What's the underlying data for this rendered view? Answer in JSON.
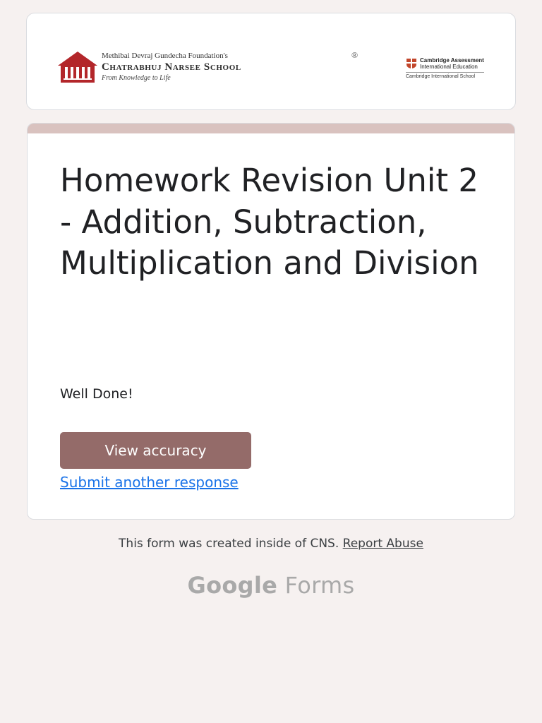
{
  "banner": {
    "school_foundation": "Methibai Devraj Gundecha Foundation's",
    "school_name": "Chatrabhuj Narsee School",
    "school_registered": "®",
    "school_tagline": "From Knowledge to Life",
    "cambridge_line1": "Cambridge Assessment",
    "cambridge_line2": "International Education",
    "cambridge_sub": "Cambridge International School"
  },
  "form": {
    "title": "Homework Revision Unit 2 - Addition, Subtraction, Multiplication and Division",
    "message": "Well Done!",
    "view_accuracy_label": "View accuracy",
    "submit_another_label": "Submit another response"
  },
  "footer": {
    "created_text": "This form was created inside of CNS.",
    "report_abuse_label": "Report Abuse",
    "google_word": "Google",
    "forms_word": "Forms"
  },
  "colors": {
    "accent": "#d9c2bf",
    "button": "#946b69",
    "link": "#1a73e8",
    "background": "#f6f1f0",
    "school_red": "#b3262a"
  }
}
